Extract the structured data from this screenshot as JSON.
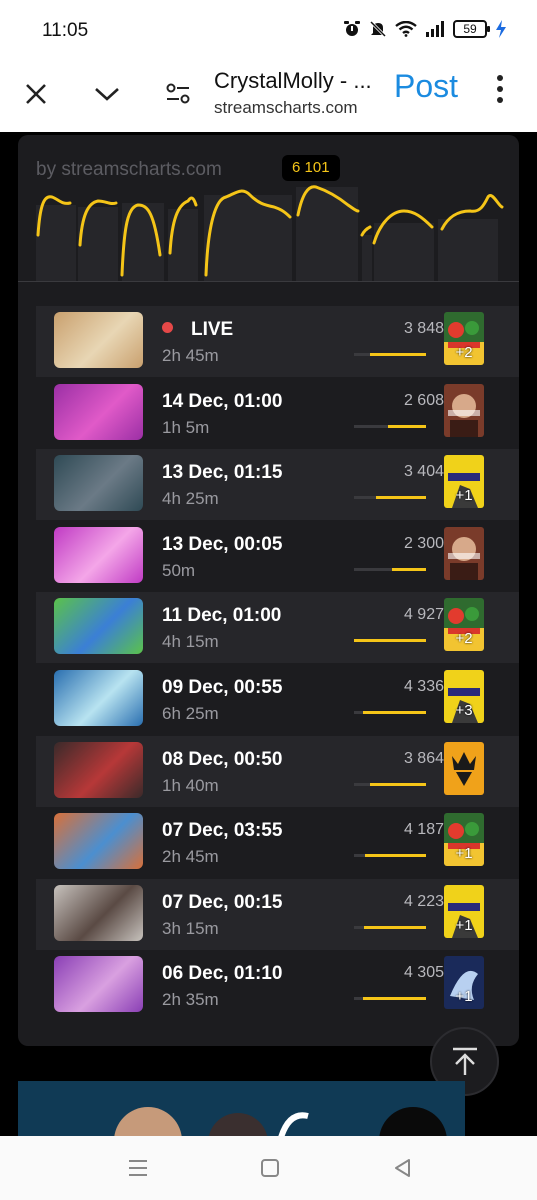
{
  "status_bar": {
    "time": "11:05",
    "battery": "59",
    "icons": [
      "alarm-icon",
      "mute-icon",
      "wifi-icon",
      "signal-icon",
      "battery-icon",
      "charging-icon"
    ]
  },
  "toolbar": {
    "title": "CrystalMolly - ...",
    "url": "streamscharts.com",
    "post_label": "Post",
    "icons": [
      "close-icon",
      "chevron-down-icon",
      "page-settings-icon",
      "more-vert-icon"
    ],
    "post_color": "#1b8be0"
  },
  "chart": {
    "by_label": "by streamscharts.com",
    "peak_label": "6 101",
    "accent_color": "#f5c518"
  },
  "streams": [
    {
      "title": "LIVE",
      "live": true,
      "duration": "2h 45m",
      "viewers": "3 848",
      "viewer_fraction": 0.78,
      "game_more": "+2",
      "game_icon": "mario-party-icon",
      "thumb_colors": [
        "#c9a06e",
        "#e8d6b4"
      ]
    },
    {
      "title": "14 Dec, 01:00",
      "live": false,
      "duration": "1h 5m",
      "viewers": "2 608",
      "viewer_fraction": 0.53,
      "game_more": "",
      "game_icon": "just-chatting-icon",
      "thumb_colors": [
        "#9b2fa5",
        "#e05ac8"
      ]
    },
    {
      "title": "13 Dec, 01:15",
      "live": false,
      "duration": "4h 25m",
      "viewers": "3 404",
      "viewer_fraction": 0.69,
      "game_more": "+1",
      "game_icon": "tekken-icon",
      "thumb_colors": [
        "#2f4a55",
        "#6b7a86"
      ]
    },
    {
      "title": "13 Dec, 00:05",
      "live": false,
      "duration": "50m",
      "viewers": "2 300",
      "viewer_fraction": 0.47,
      "game_more": "",
      "game_icon": "just-chatting-icon",
      "thumb_colors": [
        "#c03bc4",
        "#f4a6e8"
      ]
    },
    {
      "title": "11 Dec, 01:00",
      "live": false,
      "duration": "4h 15m",
      "viewers": "4 927",
      "viewer_fraction": 1.0,
      "game_more": "+2",
      "game_icon": "mario-party-icon",
      "thumb_colors": [
        "#5bc24a",
        "#3b7fd6"
      ]
    },
    {
      "title": "09 Dec, 00:55",
      "live": false,
      "duration": "6h 25m",
      "viewers": "4 336",
      "viewer_fraction": 0.88,
      "game_more": "+3",
      "game_icon": "tekken-icon",
      "thumb_colors": [
        "#2a6fb0",
        "#b8e3f0"
      ]
    },
    {
      "title": "08 Dec, 00:50",
      "live": false,
      "duration": "1h 40m",
      "viewers": "3 864",
      "viewer_fraction": 0.78,
      "game_more": "",
      "game_icon": "king-logo-icon",
      "thumb_colors": [
        "#3a2a2a",
        "#b73838"
      ]
    },
    {
      "title": "07 Dec, 03:55",
      "live": false,
      "duration": "2h 45m",
      "viewers": "4 187",
      "viewer_fraction": 0.85,
      "game_more": "+1",
      "game_icon": "mario-party-icon",
      "thumb_colors": [
        "#d8703a",
        "#4b8fd0"
      ]
    },
    {
      "title": "07 Dec, 00:15",
      "live": false,
      "duration": "3h 15m",
      "viewers": "4 223",
      "viewer_fraction": 0.86,
      "game_more": "+1",
      "game_icon": "tekken-icon",
      "thumb_colors": [
        "#c7c2bd",
        "#5a4a44"
      ]
    },
    {
      "title": "06 Dec, 01:10",
      "live": false,
      "duration": "2h 35m",
      "viewers": "4 305",
      "viewer_fraction": 0.87,
      "game_more": "+1",
      "game_icon": "pokemon-icon",
      "thumb_colors": [
        "#8a3fb5",
        "#d9a0e0"
      ]
    }
  ],
  "nav": {
    "icons": [
      "recents-icon",
      "home-icon",
      "back-icon"
    ]
  }
}
